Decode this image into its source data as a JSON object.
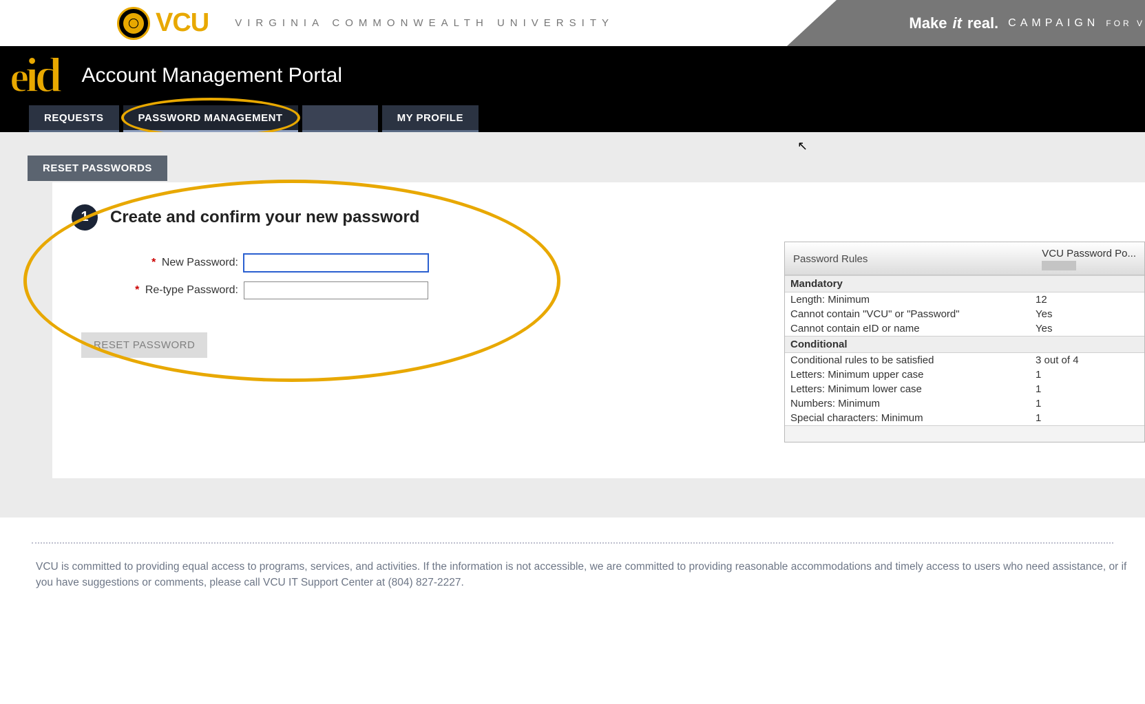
{
  "banner": {
    "vcu_word": "VCU",
    "vcu_sub": "VIRGINIA COMMONWEALTH UNIVERSITY",
    "flag_bold_1": "Make",
    "flag_bold_2": "it",
    "flag_bold_3": "real.",
    "flag_campaign": "CAMPAIGN",
    "flag_for": "FOR V"
  },
  "header": {
    "eid_logo": "eid",
    "portal_title": "Account Management Portal"
  },
  "tabs": {
    "requests": "REQUESTS",
    "password_mgmt": "PASSWORD MANAGEMENT",
    "blank": " ",
    "my_profile": "MY PROFILE"
  },
  "subtab": {
    "reset_passwords": "RESET PASSWORDS"
  },
  "step": {
    "number": "1",
    "title": "Create and confirm your new password"
  },
  "form": {
    "new_password_label": "New Password:",
    "retype_password_label": "Re-type Password:",
    "new_password_value": "",
    "retype_password_value": "",
    "reset_button": "RESET PASSWORD"
  },
  "rules": {
    "header_left": "Password Rules",
    "header_right": "VCU Password Po...",
    "mandatory_label": "Mandatory",
    "conditional_label": "Conditional",
    "mandatory": [
      {
        "k": "Length: Minimum",
        "v": "12"
      },
      {
        "k": "Cannot contain \"VCU\" or \"Password\"",
        "v": "Yes"
      },
      {
        "k": "Cannot contain eID or name",
        "v": "Yes"
      }
    ],
    "conditional": [
      {
        "k": "Conditional rules to be satisfied",
        "v": "3 out of 4"
      },
      {
        "k": "Letters: Minimum upper case",
        "v": "1"
      },
      {
        "k": "Letters: Minimum lower case",
        "v": "1"
      },
      {
        "k": "Numbers: Minimum",
        "v": "1"
      },
      {
        "k": "Special characters: Minimum",
        "v": "1"
      }
    ]
  },
  "footer": {
    "text": "VCU is committed to providing equal access to programs, services, and activities. If the information is not accessible, we are committed to providing reasonable accommodations and timely access to users who need assistance, or if you have suggestions or comments, please call VCU IT Support Center at (804) 827-2227."
  }
}
